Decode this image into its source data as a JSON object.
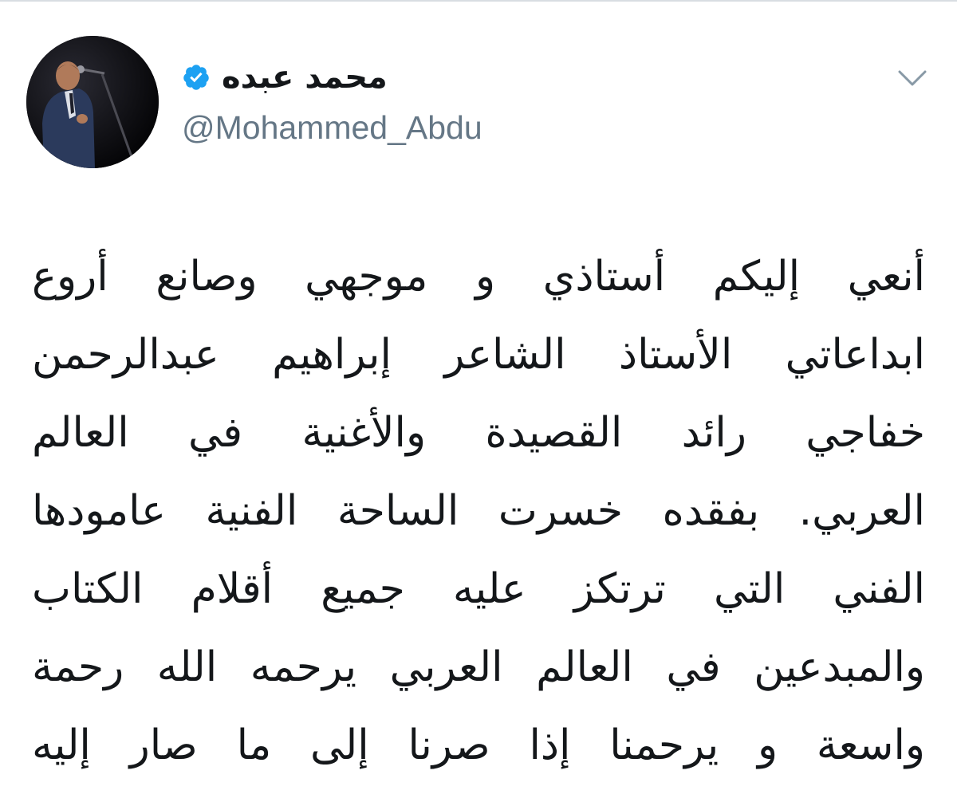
{
  "tweet": {
    "author": {
      "display_name": "محمد عبده",
      "handle": "@Mohammed_Abdu",
      "verified": true,
      "verified_icon": "verified-badge-icon",
      "verified_color": "#1da1f2"
    },
    "menu_icon": "chevron-down-icon",
    "text_lines": [
      "أنعي إليكم أستاذي و موجهي وصانع أروع",
      "ابداعاتي الأستاذ الشاعر إبراهيم عبدالرحمن",
      "خفاجي رائد القصيدة والأغنية في العالم",
      "العربي. بفقده خسرت الساحة الفنية عامودها",
      "الفني التي ترتكز عليه جميع أقلام الكتاب",
      "والمبدعين في العالم العربي يرحمه الله رحمة",
      "واسعة و يرحمنا إذا صرنا إلى ما صار إليه"
    ]
  }
}
